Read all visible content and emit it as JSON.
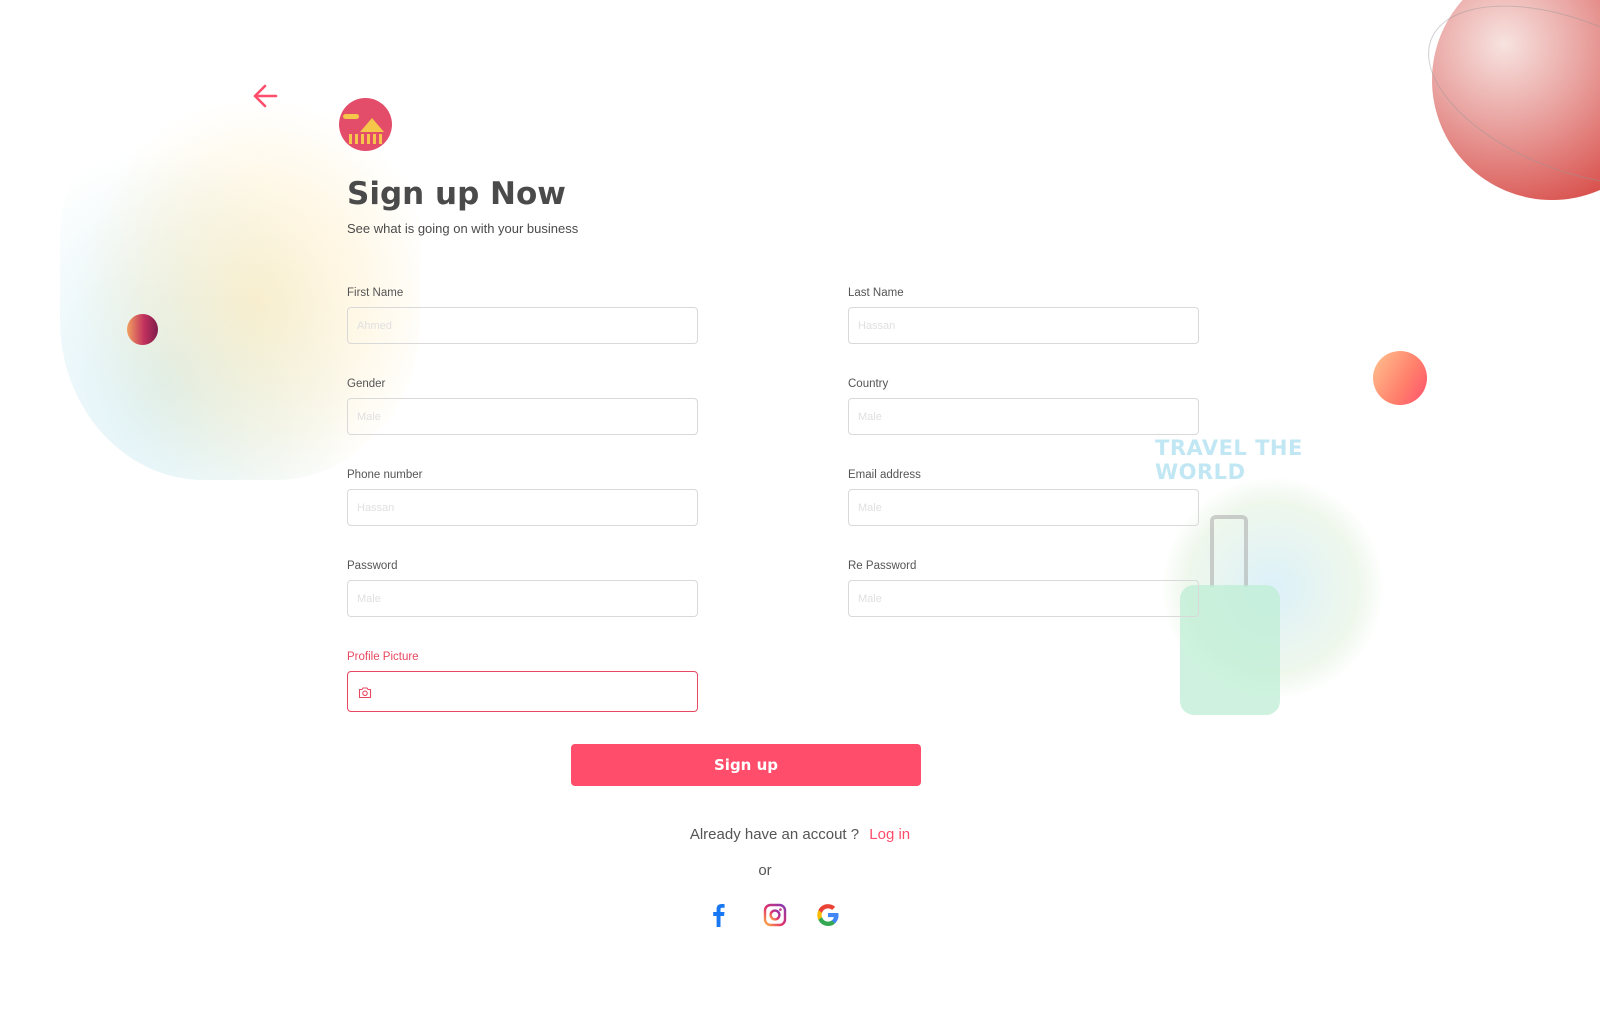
{
  "colors": {
    "accent": "#ff4d6b",
    "accent_dark": "#e8485f",
    "text": "#4a4a4a",
    "border": "#d9d9d9"
  },
  "decoration": {
    "travel_text": "TRAVEL THE WORLD"
  },
  "header": {
    "back_icon": "arrow-left-icon",
    "logo_icon": "logo-icon",
    "title": "Sign up Now",
    "subtitle": "See what is going on with your business"
  },
  "form": {
    "first_name": {
      "label": "First Name",
      "placeholder": "Ahmed"
    },
    "last_name": {
      "label": "Last Name",
      "placeholder": "Hassan"
    },
    "gender": {
      "label": "Gender",
      "placeholder": "Male"
    },
    "country": {
      "label": "Country",
      "placeholder": "Male"
    },
    "phone": {
      "label": "Phone number",
      "placeholder": "Hassan"
    },
    "email": {
      "label": "Email address",
      "placeholder": "Male"
    },
    "password": {
      "label": "Password",
      "placeholder": "Male"
    },
    "re_password": {
      "label": "Re  Password",
      "placeholder": "Male"
    },
    "profile_picture": {
      "label": "Profile Picture",
      "icon": "camera-icon"
    }
  },
  "actions": {
    "signup_label": "Sign up",
    "login_prompt": "Already have an accout ?",
    "login_link": "Log in",
    "or_text": "or"
  },
  "socials": [
    {
      "name": "facebook",
      "icon": "facebook-icon"
    },
    {
      "name": "instagram",
      "icon": "instagram-icon"
    },
    {
      "name": "google",
      "icon": "google-icon"
    }
  ]
}
